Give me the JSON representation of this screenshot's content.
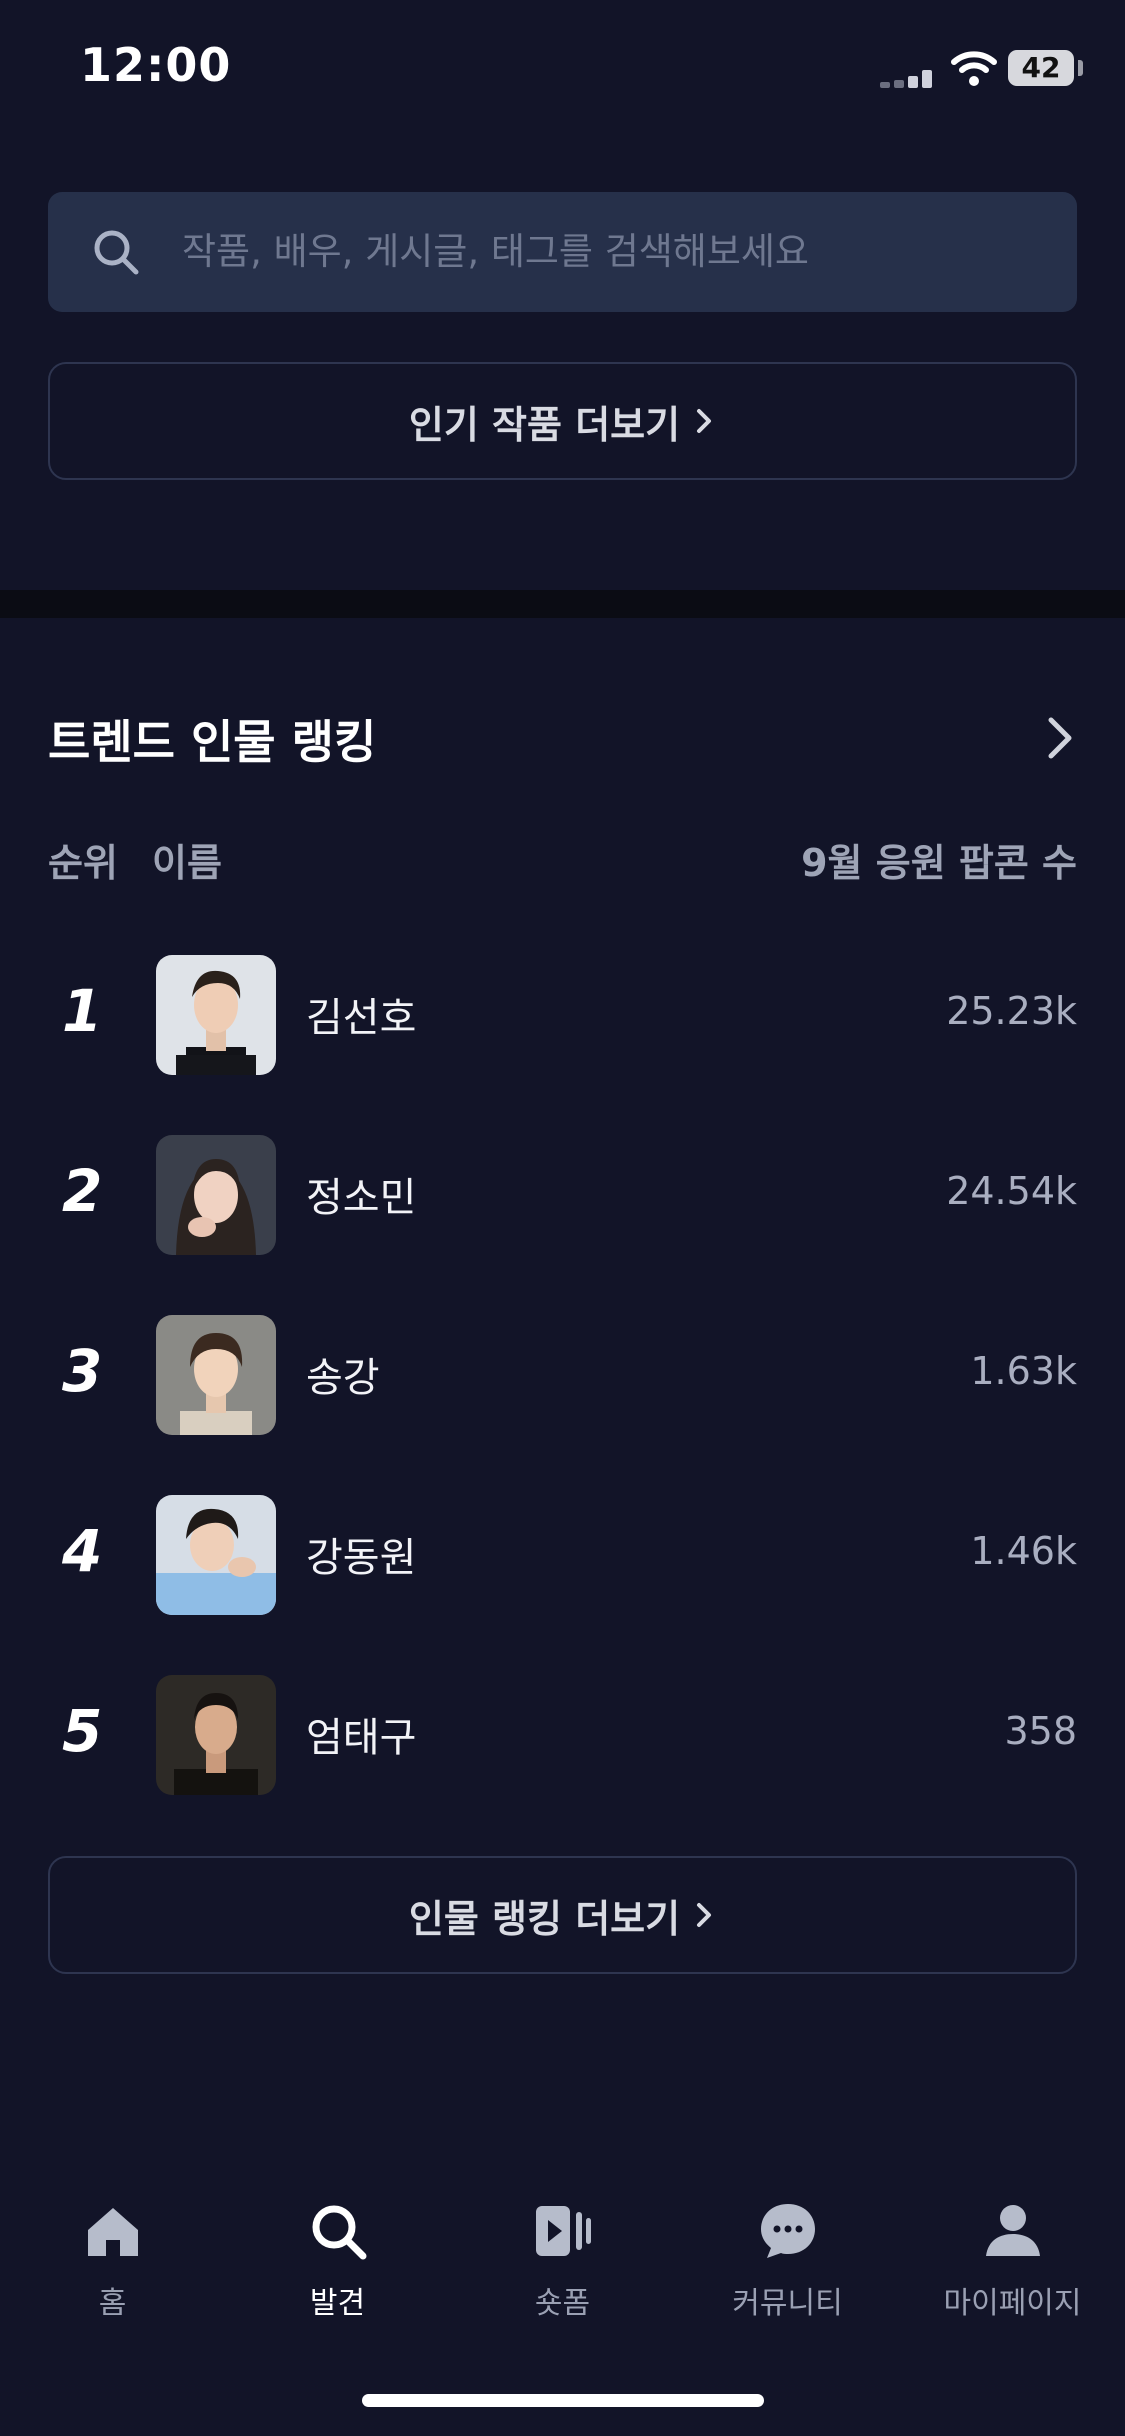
{
  "status_bar": {
    "time": "12:00",
    "battery": "42"
  },
  "search": {
    "placeholder": "작품, 배우, 게시글, 태그를 검색해보세요"
  },
  "popular_more_button": "인기 작품 더보기",
  "ranking": {
    "title": "트렌드 인물 랭킹",
    "col_rank": "순위",
    "col_name": "이름",
    "col_metric": "9월 응원 팝콘 수",
    "rows": [
      {
        "rank": "1",
        "name": "김선호",
        "value": "25.23k"
      },
      {
        "rank": "2",
        "name": "정소민",
        "value": "24.54k"
      },
      {
        "rank": "3",
        "name": "송강",
        "value": "1.63k"
      },
      {
        "rank": "4",
        "name": "강동원",
        "value": "1.46k"
      },
      {
        "rank": "5",
        "name": "엄태구",
        "value": "358"
      }
    ],
    "more_button": "인물 랭킹 더보기"
  },
  "tabs": [
    {
      "label": "홈",
      "icon": "home-icon",
      "active": false
    },
    {
      "label": "발견",
      "icon": "search-icon",
      "active": true
    },
    {
      "label": "숏폼",
      "icon": "shortform-icon",
      "active": false
    },
    {
      "label": "커뮤니티",
      "icon": "chat-bubble-icon",
      "active": false
    },
    {
      "label": "마이페이지",
      "icon": "profile-icon",
      "active": false
    }
  ],
  "colors": {
    "background": "#121428",
    "search_bg": "#26304a",
    "muted_text": "#a9aec0"
  }
}
